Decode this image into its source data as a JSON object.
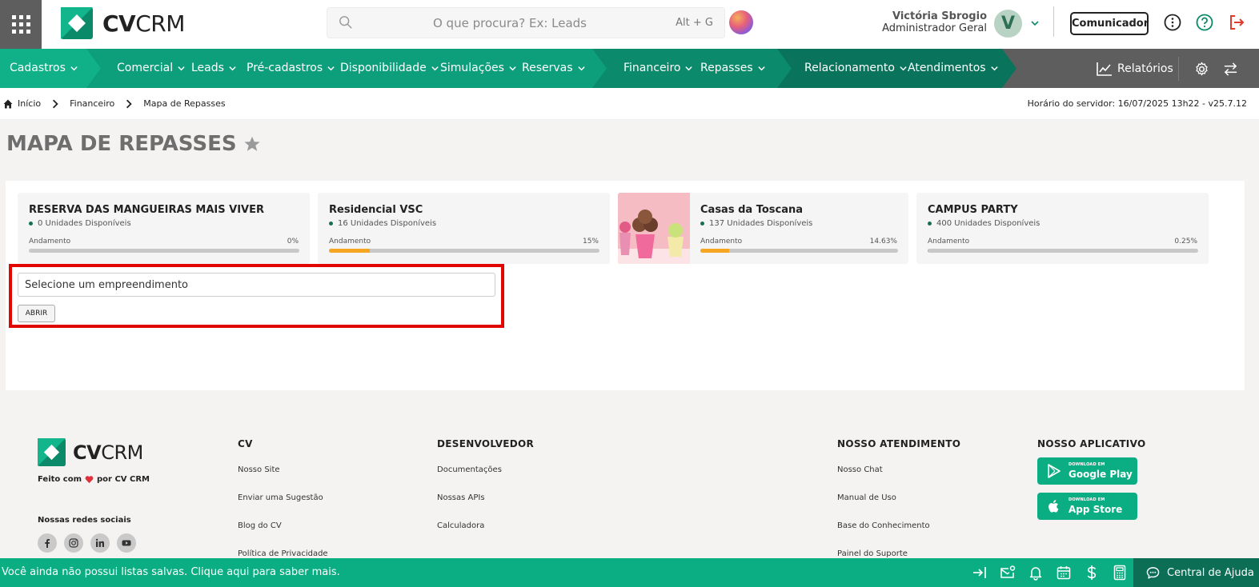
{
  "header": {
    "logo_bold": "CV",
    "logo_light": "CRM",
    "search_placeholder": "O que procura? Ex: Leads",
    "search_shortcut": "Alt + G",
    "user_name": "Victória Sbrogio",
    "user_role": "Administrador Geral",
    "avatar_initial": "V",
    "comunicador_label": "Comunicador"
  },
  "nav": {
    "items": [
      {
        "label": "Cadastros"
      },
      {
        "label": "Comercial"
      },
      {
        "label": "Leads"
      },
      {
        "label": "Pré-cadastros"
      },
      {
        "label": "Disponibilidade"
      },
      {
        "label": "Simulações"
      },
      {
        "label": "Reservas"
      },
      {
        "label": "Financeiro"
      },
      {
        "label": "Repasses"
      },
      {
        "label": "Relacionamento"
      },
      {
        "label": "Atendimentos"
      }
    ],
    "reports_label": "Relatórios",
    "colors": {
      "seg1": "#10b088",
      "seg2": "#0d9e7b",
      "seg3": "#0b8a6c",
      "seg4": "#0a735c",
      "bg": "#5e5e5e"
    }
  },
  "breadcrumb": {
    "items": [
      "Início",
      "Financeiro",
      "Mapa de Repasses"
    ],
    "server_time": "Horário do servidor: 16/07/2025 13h22 - v25.7.12"
  },
  "page": {
    "title": "MAPA DE REPASSES"
  },
  "cards": [
    {
      "title": "RESERVA DAS MANGUEIRAS MAIS VIVER",
      "units": "0 Unidades Disponíveis",
      "progress_label": "Andamento",
      "percent_text": "0%",
      "percent": 0
    },
    {
      "title": "Residencial VSC",
      "units": "16 Unidades Disponíveis",
      "progress_label": "Andamento",
      "percent_text": "15%",
      "percent": 15
    },
    {
      "title": "Casas da Toscana",
      "units": "137 Unidades Disponíveis",
      "progress_label": "Andamento",
      "percent_text": "14.63%",
      "percent": 14.63
    },
    {
      "title": "CAMPUS PARTY",
      "units": "400 Unidades Disponíveis",
      "progress_label": "Andamento",
      "percent_text": "0.25%",
      "percent": 0.25
    }
  ],
  "form": {
    "select_value": "Selecione um empreendimento",
    "open_button": "ABRIR"
  },
  "footer": {
    "made_prefix": "Feito com",
    "made_suffix": "por CV CRM",
    "social_title": "Nossas redes sociais",
    "col_cv": {
      "title": "CV",
      "links": [
        "Nosso Site",
        "Enviar uma Sugestão",
        "Blog do CV",
        "Política de Privacidade"
      ]
    },
    "col_dev": {
      "title": "DESENVOLVEDOR",
      "links": [
        "Documentações",
        "Nossas APIs",
        "Calculadora"
      ]
    },
    "col_support": {
      "title": "NOSSO ATENDIMENTO",
      "links": [
        "Nosso Chat",
        "Manual de Uso",
        "Base do Conhecimento",
        "Painel do Suporte"
      ]
    },
    "col_app": {
      "title": "NOSSO APLICATIVO"
    },
    "google_small": "DOWNLOAD EM",
    "google_big": "Google Play",
    "apple_small": "DOWNLOAD EM",
    "apple_big": "App Store"
  },
  "bottombar": {
    "message": "Você ainda não possui listas salvas. Clique aqui para saber mais.",
    "help_label": "Central de Ajuda"
  }
}
